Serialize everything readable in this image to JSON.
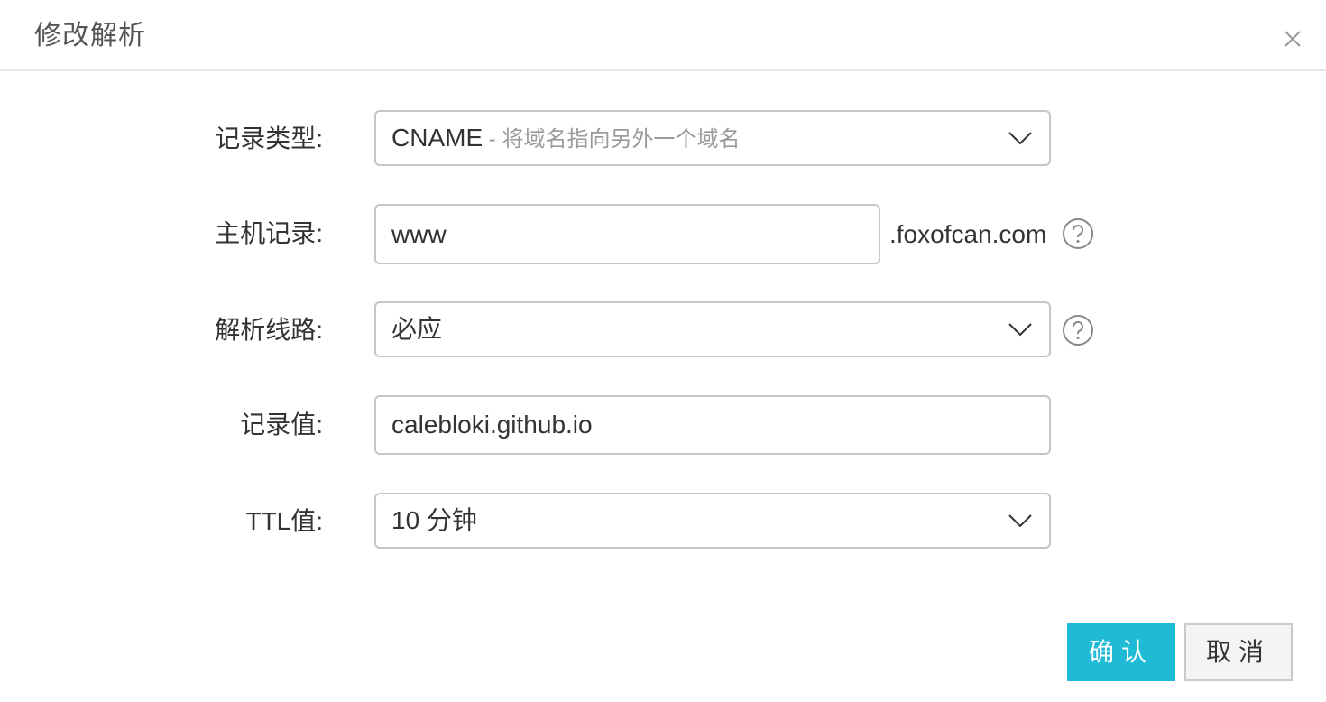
{
  "dialog": {
    "title": "修改解析",
    "close_icon": "close-icon"
  },
  "form": {
    "record_type": {
      "label": "记录类型:",
      "value": "CNAME",
      "hint": " - 将域名指向另外一个域名"
    },
    "host_record": {
      "label": "主机记录:",
      "value": "www",
      "suffix": ".foxofcan.com",
      "help_icon": "question-circle-icon"
    },
    "line": {
      "label": "解析线路:",
      "value": "必应",
      "help_icon": "question-circle-icon"
    },
    "record_value": {
      "label": "记录值:",
      "value": "calebloki.github.io"
    },
    "ttl": {
      "label": "TTL值:",
      "value": "10 分钟"
    }
  },
  "buttons": {
    "confirm": "确认",
    "cancel": "取消"
  },
  "colors": {
    "primary": "#1fbad6",
    "border": "#c4c6cc",
    "text": "#333333",
    "hint": "#9a9a9a"
  }
}
